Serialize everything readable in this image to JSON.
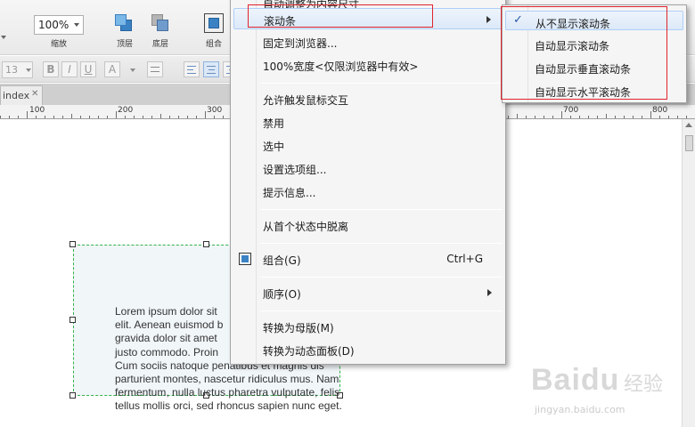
{
  "toolbar": {
    "zoom_value": "100%",
    "zoom_label": "缩放",
    "front_label": "顶层",
    "back_label": "底层",
    "group_label": "组合",
    "font_size_value": "13",
    "bold_glyph": "B",
    "italic_glyph": "I",
    "underline_glyph": "U",
    "font_color_glyph": "A"
  },
  "tabs": [
    {
      "label": "index",
      "close": "✕"
    }
  ],
  "ruler": {
    "labels": [
      "100",
      "200",
      "300",
      "700",
      "800"
    ]
  },
  "canvas": {
    "lorem_lines": [
      "Lorem ipsum dolor sit",
      "elit. Aenean euismod b",
      "gravida dolor sit amet",
      "justo commodo. Proin",
      "Cum sociis natoque penatibus et magnis dis",
      "parturient montes, nascetur ridiculus mus. Nam",
      "fermentum, nulla luctus pharetra vulputate, felis",
      "tellus mollis orci, sed rhoncus sapien nunc eget."
    ]
  },
  "context_menu": {
    "items": [
      {
        "label": "自动调整为内容尺寸"
      },
      {
        "label": "滚动条",
        "submenu": true,
        "highlighted": true
      },
      {
        "label": "固定到浏览器..."
      },
      {
        "label": "100%宽度<仅限浏览器中有效>"
      },
      {
        "label": "允许触发鼠标交互"
      },
      {
        "label": "禁用"
      },
      {
        "label": "选中"
      },
      {
        "label": "设置选项组..."
      },
      {
        "label": "提示信息..."
      },
      {
        "label": "从首个状态中脱离"
      },
      {
        "label": "组合(G)",
        "shortcut": "Ctrl+G",
        "icon": "group-icon"
      },
      {
        "label": "顺序(O)",
        "submenu": true
      },
      {
        "label": "转换为母版(M)"
      },
      {
        "label": "转换为动态面板(D)"
      }
    ]
  },
  "scroll_submenu": {
    "items": [
      {
        "label": "从不显示滚动条",
        "checked": true,
        "check_glyph": "✓"
      },
      {
        "label": "自动显示滚动条"
      },
      {
        "label": "自动显示垂直滚动条"
      },
      {
        "label": "自动显示水平滚动条"
      }
    ]
  },
  "watermark": {
    "brand": "Baidu",
    "cn": "经验",
    "url": "jingyan.baidu.com"
  },
  "colors": {
    "annotation_red": "#e0242b",
    "selection_green": "#32b24a",
    "menu_highlight": "#dce9f8",
    "check_blue": "#2a5aa8"
  }
}
